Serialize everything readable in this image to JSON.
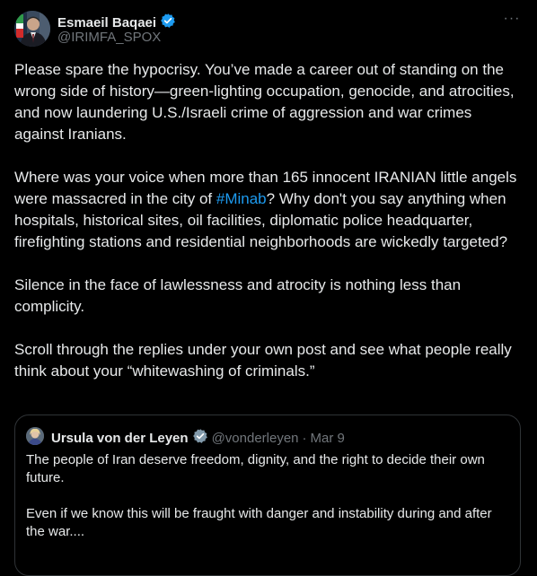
{
  "author": {
    "name": "Esmaeil Baqaei",
    "handle": "@IRIMFA_SPOX"
  },
  "menu": {
    "more_label": "···"
  },
  "post": {
    "p1": "Please spare the hypocrisy. You’ve made a career out of standing on the wrong side of history—green-lighting occupation, genocide, and atrocities, and now laundering U.S./Israeli crime of aggression and war crimes against Iranians.",
    "p2_before": "Where was your voice when more than 165 innocent IRANIAN little angels were massacred in the city of ",
    "p2_hashtag": "#Minab",
    "p2_after": "? Why don't you say anything when hospitals, historical sites, oil facilities, diplomatic police headquarter, firefighting stations and residential neighborhoods are wickedly targeted?",
    "p3": "Silence in the face of lawlessness and atrocity is nothing less than complicity.",
    "p4": "Scroll through the replies under your own post and see what people really think about your “whitewashing of criminals.”"
  },
  "quote": {
    "name": "Ursula von der Leyen",
    "handle": "@vonderleyen",
    "separator": "·",
    "date": "Mar 9",
    "p1": "The people of Iran deserve freedom, dignity, and the right to decide their own future.",
    "p2": "Even if we know this will be fraught with danger and instability during and after the war...."
  },
  "colors": {
    "background": "#000000",
    "text": "#e7e9ea",
    "secondary": "#71767b",
    "link": "#1d9bf0",
    "verified_blue": "#1d9bf0",
    "verified_gray": "#829aab",
    "border": "#2f3336"
  },
  "icons": {
    "verified_author": "verified-badge-blue-icon",
    "verified_quote": "verified-badge-gray-icon",
    "more": "more-dots-icon"
  }
}
